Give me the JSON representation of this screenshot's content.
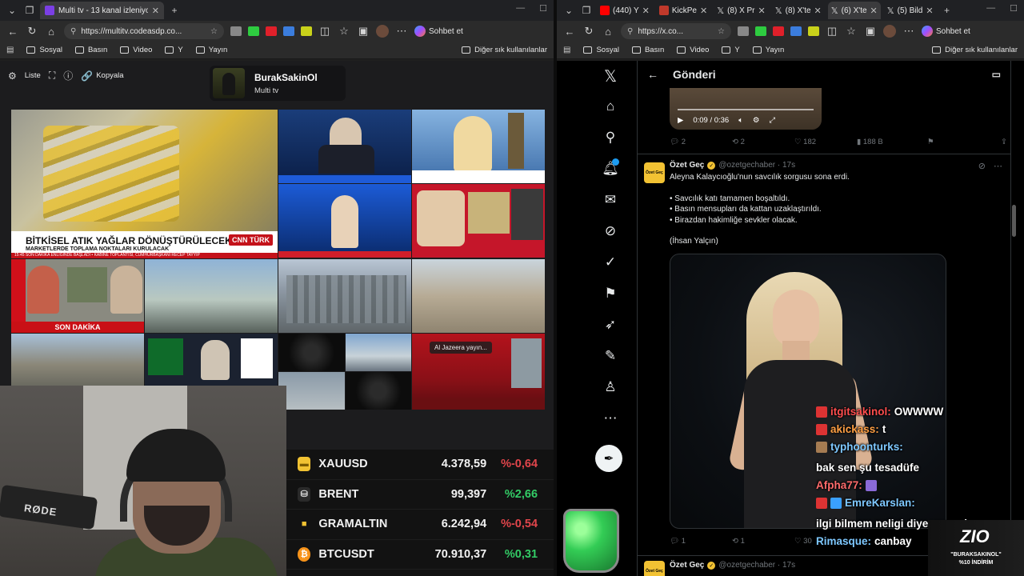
{
  "left_window": {
    "tabs": [
      {
        "title": "Multi tv - 13 kanal izleniyor",
        "close": "✕",
        "active": true
      }
    ],
    "new_tab": "+",
    "url": "https://multitv.codeasdp.co...",
    "chat_button": "Sohbet et",
    "bookmarks": [
      "Sosyal",
      "Basın",
      "Video",
      "Y",
      "Yayın"
    ],
    "bookmarks_right": "Diğer sık kullanılanlar"
  },
  "right_window": {
    "tabs": [
      {
        "title": "(440) Y",
        "fav_color": "#ff0000"
      },
      {
        "title": "KickPe",
        "fav_color": "#c0392b"
      },
      {
        "title": "(8) X Pr",
        "fav_color": "#000000"
      },
      {
        "title": "(8) X'te",
        "fav_color": "#000000"
      },
      {
        "title": "(6) X'te",
        "fav_color": "#000000",
        "active": true
      },
      {
        "title": "(5) Bild",
        "fav_color": "#000000"
      }
    ],
    "url": "https://x.co...",
    "chat_button": "Sohbet et",
    "bookmarks": [
      "Sosyal",
      "Basın",
      "Video",
      "Y",
      "Yayın"
    ],
    "bookmarks_right": "Diğer sık kullanılanlar"
  },
  "multitv": {
    "toolbar": {
      "list": "Liste",
      "copy": "Kopyala"
    },
    "channel": {
      "name": "BurakSakinOl",
      "subtitle": "Multi tv"
    },
    "cells": {
      "cnn_headline": "BİTKİSEL ATIK YAĞLAR DÖNÜŞTÜRÜLECEK",
      "cnn_sub": "MARKETLERDE TOPLAMA NOKTALARI KURULACAK",
      "cnn_logo": "CNN TÜRK",
      "cnn_strip": "15:45  SON DAKİKA  ENLİĞİNDE BAŞLADI  •  KABİNE TOPLANTISI, CUMHURBAŞKANI RECEP TAYYİP",
      "son_dakika": "SON DAKİKA",
      "aljazeera": "Al Jazeera yayın..."
    }
  },
  "tickers": [
    {
      "symbol": "XAUUSD",
      "value": "4.378,59",
      "change": "%-0,64",
      "color": "#e0454b",
      "icon_bg": "#f1c232",
      "icon": "▬"
    },
    {
      "symbol": "BRENT",
      "value": "99,397",
      "change": "%2,66",
      "color": "#33cc66",
      "icon_bg": "#2a2a2a",
      "icon": "⛁"
    },
    {
      "symbol": "GRAMALTIN",
      "value": "6.242,94",
      "change": "%-0,54",
      "color": "#e0454b",
      "icon_bg": "#121212",
      "icon": "■"
    },
    {
      "symbol": "BTCUSDT",
      "value": "70.910,37",
      "change": "%0,31",
      "color": "#33cc66",
      "icon_bg": "#f7931a",
      "icon": "₿"
    }
  ],
  "webcam": {
    "mic_label": "RØDE"
  },
  "x": {
    "header": "Gönderi",
    "video_time": "0:09 / 0:36",
    "post_actions": {
      "replies": "2",
      "reposts": "2",
      "likes": "182",
      "views": "188 B"
    },
    "tweet": {
      "name": "Özet Geç",
      "handle": "@ozetgechaber · 17s",
      "avatar_text": "Özet Geç",
      "lines": [
        "Aleyna Kalaycıoğlu'nun savcılık sorgusu sona erdi.",
        "",
        "• Savcılık katı tamamen boşaltıldı.",
        "• Basın mensupları da kattan uzaklaştırıldı.",
        "• Birazdan hakimliğe sevkler olacak.",
        "",
        "(İhsan Yalçın)"
      ],
      "actions": {
        "replies": "1",
        "reposts": "1",
        "likes": "30"
      }
    },
    "tweet2": {
      "name": "Özet Geç",
      "handle": "@ozetgechaber · 17s"
    }
  },
  "chat": [
    {
      "user": "itgitsakinol:",
      "msg": "OWWWW",
      "color": "#ff4d4d"
    },
    {
      "user": "akickass:",
      "msg": "t",
      "color": "#ff9f43"
    },
    {
      "user": "typhoonturks:",
      "msg": "bak sen şu tesadüfe",
      "color": "#7ec8ff"
    },
    {
      "user": "Afpha77:",
      "msg": "",
      "color": "#ff6b6b"
    },
    {
      "user": "EmreKarslan:",
      "msg": "ilgi bilmem neligi diye yorumla",
      "color": "#7ec8ff"
    },
    {
      "user": "Rimasque:",
      "msg": "canbay",
      "color": "#7ec8ff"
    }
  ],
  "promo": {
    "brand": "ZIO",
    "line1": "\"BURAKSAKINOL\"",
    "line2": "%10 İNDİRİM"
  }
}
